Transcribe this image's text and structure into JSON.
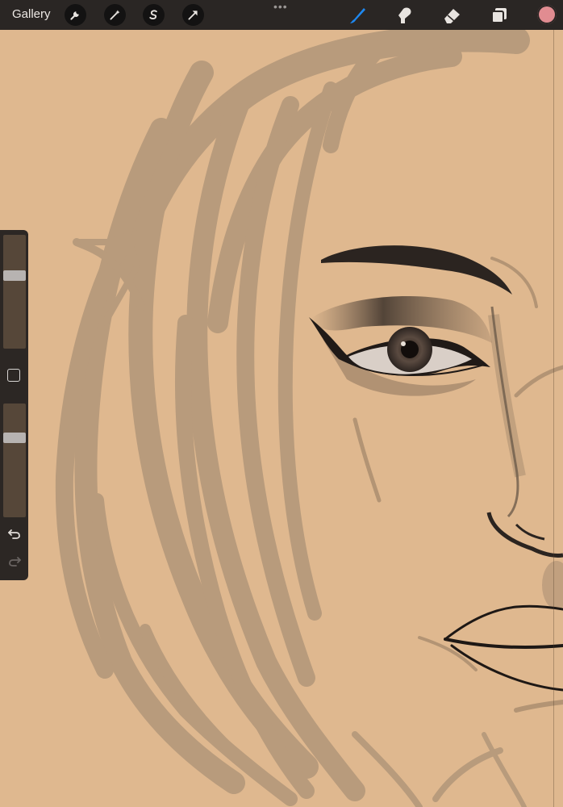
{
  "toolbar": {
    "gallery_label": "Gallery",
    "left_tools": [
      {
        "name": "wrench-icon"
      },
      {
        "name": "magic-wand-icon"
      },
      {
        "name": "selection-s-icon"
      },
      {
        "name": "transform-arrow-icon"
      }
    ],
    "more_label": "•••",
    "right_tools": [
      {
        "name": "brush-icon",
        "active": true
      },
      {
        "name": "smudge-icon"
      },
      {
        "name": "eraser-icon"
      },
      {
        "name": "layers-icon"
      }
    ],
    "current_color": "#e18c91",
    "active_tool_color": "#1e88f0"
  },
  "sidebar": {
    "brush_size_level": 0.66,
    "opacity_level": 0.72
  },
  "canvas": {
    "background": "#dfb88f",
    "sketch_color": "#b09270"
  }
}
